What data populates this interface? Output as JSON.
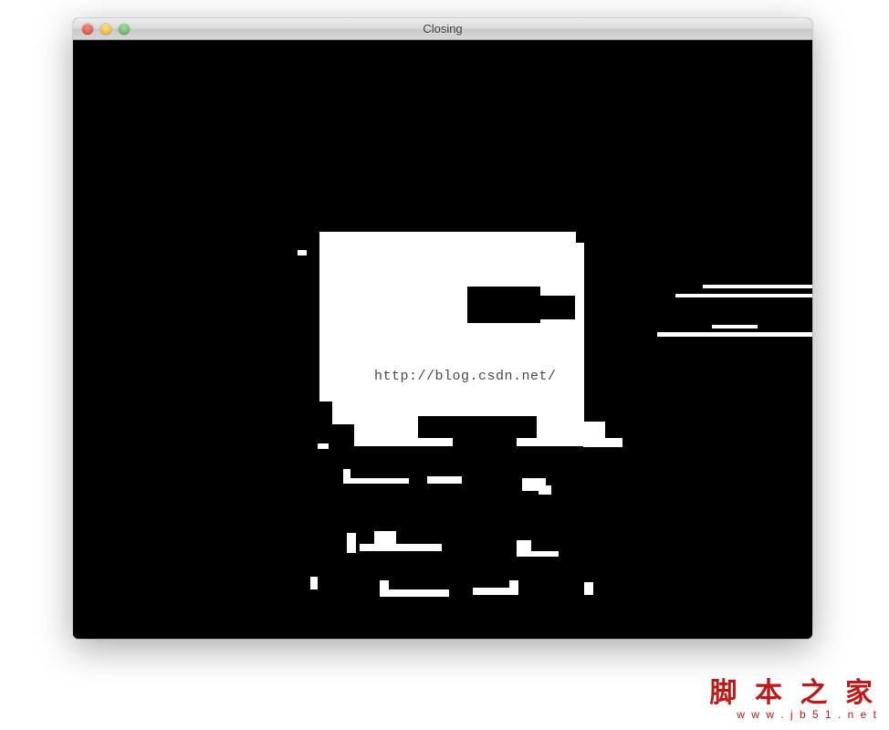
{
  "window": {
    "title": "Closing"
  },
  "watermarks": {
    "center_url": "http://blog.csdn.net/",
    "site_cn": "脚 本 之 家",
    "site_en": "w w w . j b 5 1 . n e t"
  }
}
